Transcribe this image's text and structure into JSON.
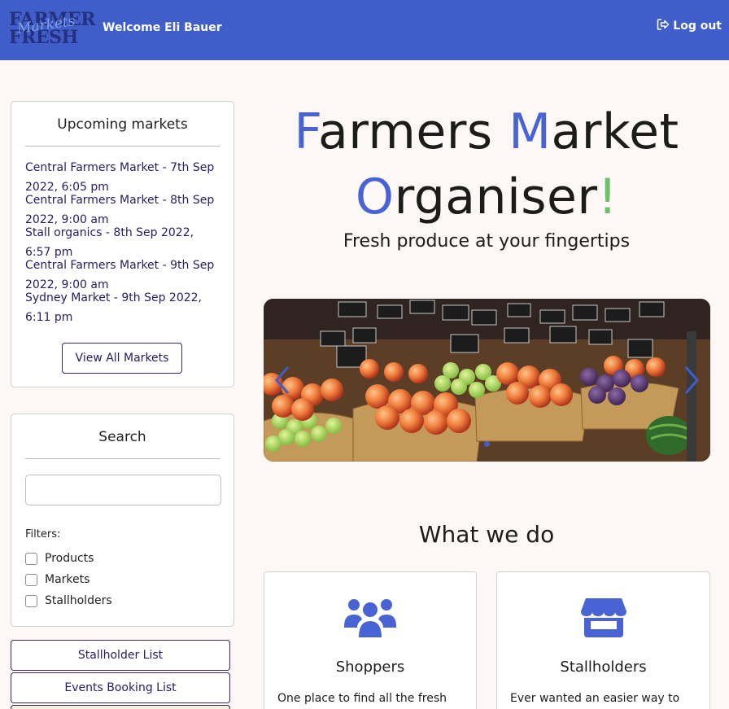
{
  "header": {
    "logo": {
      "line1": "FARMER",
      "script": "Markets",
      "line2": "FRESH"
    },
    "welcome": "Welcome Eli Bauer",
    "logout_label": "Log out",
    "logout_icon": "sign-out-icon",
    "bg_color": "#3f5ec9"
  },
  "sidebar": {
    "upcoming": {
      "title": "Upcoming markets",
      "items": [
        "Central Farmers Market - 7th Sep 2022, 6:05 pm",
        "Central Farmers Market - 8th Sep 2022, 9:00 am",
        "Stall organics - 8th Sep 2022, 6:57 pm",
        "Central Farmers Market - 9th Sep 2022, 9:00 am",
        "Sydney Market - 9th Sep 2022, 6:11 pm"
      ],
      "button_label": "View All Markets"
    },
    "search": {
      "title": "Search",
      "input_value": "",
      "filters_label": "Filters:",
      "filters": [
        "Products",
        "Markets",
        "Stallholders"
      ]
    },
    "buttons": [
      "Stallholder List",
      "Events Booking List"
    ]
  },
  "hero": {
    "title_parts": [
      "F",
      "armers ",
      "M",
      "arket",
      "O",
      "rganiser",
      "!"
    ],
    "subtitle": "Fresh produce at your fingertips",
    "accent_blue": "#4a63d4",
    "accent_green": "#6bc16a"
  },
  "carousel": {
    "prev_icon": "chevron-left-icon",
    "next_icon": "chevron-right-icon",
    "active_index": 0
  },
  "what_we_do": {
    "title": "What we do",
    "cards": [
      {
        "icon": "users-icon",
        "title": "Shoppers",
        "text": "One place to find all the fresh"
      },
      {
        "icon": "store-icon",
        "title": "Stallholders",
        "text": "Ever wanted an easier way to"
      }
    ]
  }
}
